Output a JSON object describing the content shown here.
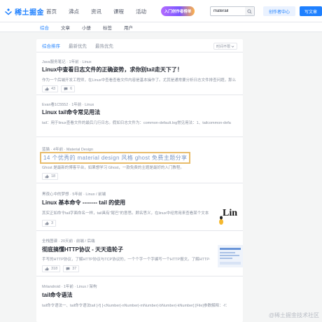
{
  "header": {
    "logo_text": "稀土掘金",
    "nav": [
      "首页",
      "沸点",
      "资讯",
      "课程",
      "活动"
    ],
    "promo_text": "入门创作者榜单",
    "search_value": "materail",
    "creator_label": "创作者中心",
    "write_label": "写文章"
  },
  "categories": [
    "综合",
    "文章",
    "小册",
    "标签",
    "用户"
  ],
  "sort": {
    "options": [
      "综合排序",
      "最新优先",
      "最热优先"
    ],
    "time_filter": "时间不限"
  },
  "articles": [
    {
      "meta": "Java服务笔记 · 1年前 · Linux",
      "title": "Linux中查看日志文件的正确姿势，求你别tail走天下了！",
      "abstract": "作为一个后端开发工程师，在Linux中查看查看文件内容是基本操作了。尤其是通常要分析日志文件排查问题，那么",
      "likes": "43",
      "comments": "6"
    },
    {
      "meta": "Evan看1C5552 · 1年前 · Linux",
      "title": "Linux tail命令常见用法",
      "abstract": "tail：用于linux查看文件的最后几行日志。假如日志文件为：common-default.log常见用法：1、tailcommon-defa"
    },
    {
      "meta": "蓝猫 · 4年前 · Material Design",
      "title": "14 个优秀的 material design 风格 ghost 免费主题分享",
      "abstract": "Ghost 是最新的博客平台，如果想学习 Ghost，一款免费的主题是最好的入门教程。",
      "likes": "18"
    },
    {
      "meta": "黑夜心中的梦想 · 5年前 · Linux / 前端",
      "title": "Linux 基本命令 -------- tail 的使用",
      "abstract": "其实正如命令tail字面命名一样，tail具有\"尾巴\"的意思。顾名思义，在linux中经常用来查看某个文本",
      "likes": "3",
      "thumb_text": "Lin"
    },
    {
      "meta": "全栈图谱 · 20天前 · 前端 / 后端",
      "title": "彻底搞懂HTTP协议 - 天天造轮子",
      "abstract": "手写的HTTP协议，了解HTTP协议与TCP协议的，一个个字一个字编写一个HTTP报文。了解HTTP与",
      "likes": "318",
      "comments": "37"
    },
    {
      "meta": "Mrlandroid · 1年前 · Linux / 架构",
      "title": "tail命令语法",
      "abstract": "tail命令语法一、tail命令语法tail [-f] [-cNumber|-nNumber|-mNumber|-bNumber|-kNumber] [File]参数解释：-f："
    }
  ],
  "watermark": "@稀土掘金技术社区",
  "colors": {
    "brand": "#1e80ff",
    "highlight_border": "#e8bc6a"
  },
  "icons": [
    "juejin-logo-icon",
    "search-icon",
    "like-icon",
    "comment-icon",
    "chevron-down-icon"
  ]
}
